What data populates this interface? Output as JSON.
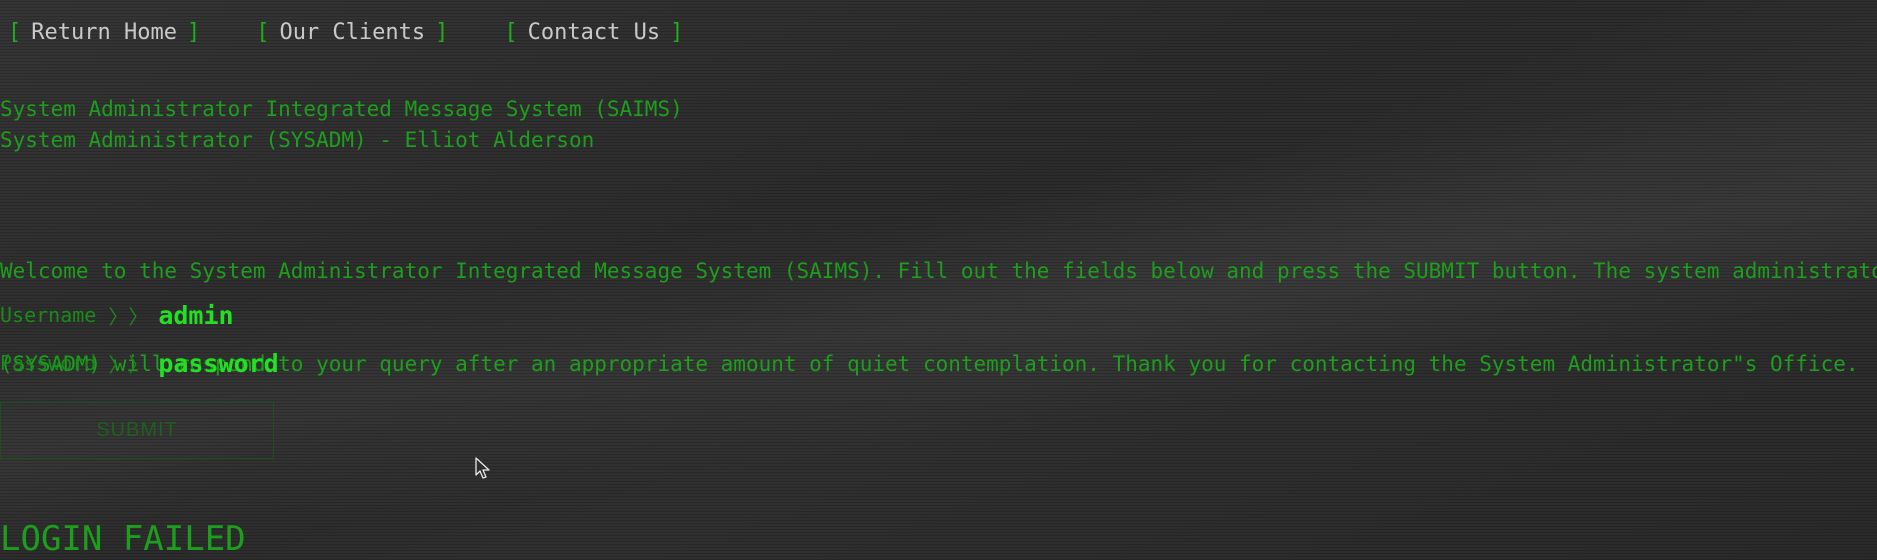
{
  "nav": {
    "bracket_open": "[",
    "bracket_close": "]",
    "links": [
      {
        "label": "Return Home"
      },
      {
        "label": "Our Clients"
      },
      {
        "label": "Contact Us"
      }
    ]
  },
  "header": {
    "system_name": "System Administrator Integrated Message System (SAIMS)",
    "administrator": "System Administrator (SYSADM) - Elliot Alderson"
  },
  "welcome": {
    "line1": "Welcome to the System Administrator Integrated Message System (SAIMS). Fill out the fields below and press the SUBMIT button. The system administrator",
    "line2": "(SYSADM) will respond to your query after an appropriate amount of quiet contemplation. Thank you for contacting the System Administrator\"s Office."
  },
  "form": {
    "username_label": "Username",
    "password_label": "Password",
    "separator": "〉〉",
    "username_value": "admin",
    "password_value": "password",
    "submit_label": "SUBMIT"
  },
  "status": {
    "message": "LOGIN FAILED"
  },
  "colors": {
    "background": "#2d2d2d",
    "text_green": "#1d9e1d",
    "input_green": "#22e022",
    "nav_text": "#c9c9c9"
  },
  "icons": {
    "pointer": "mouse-pointer-icon"
  }
}
